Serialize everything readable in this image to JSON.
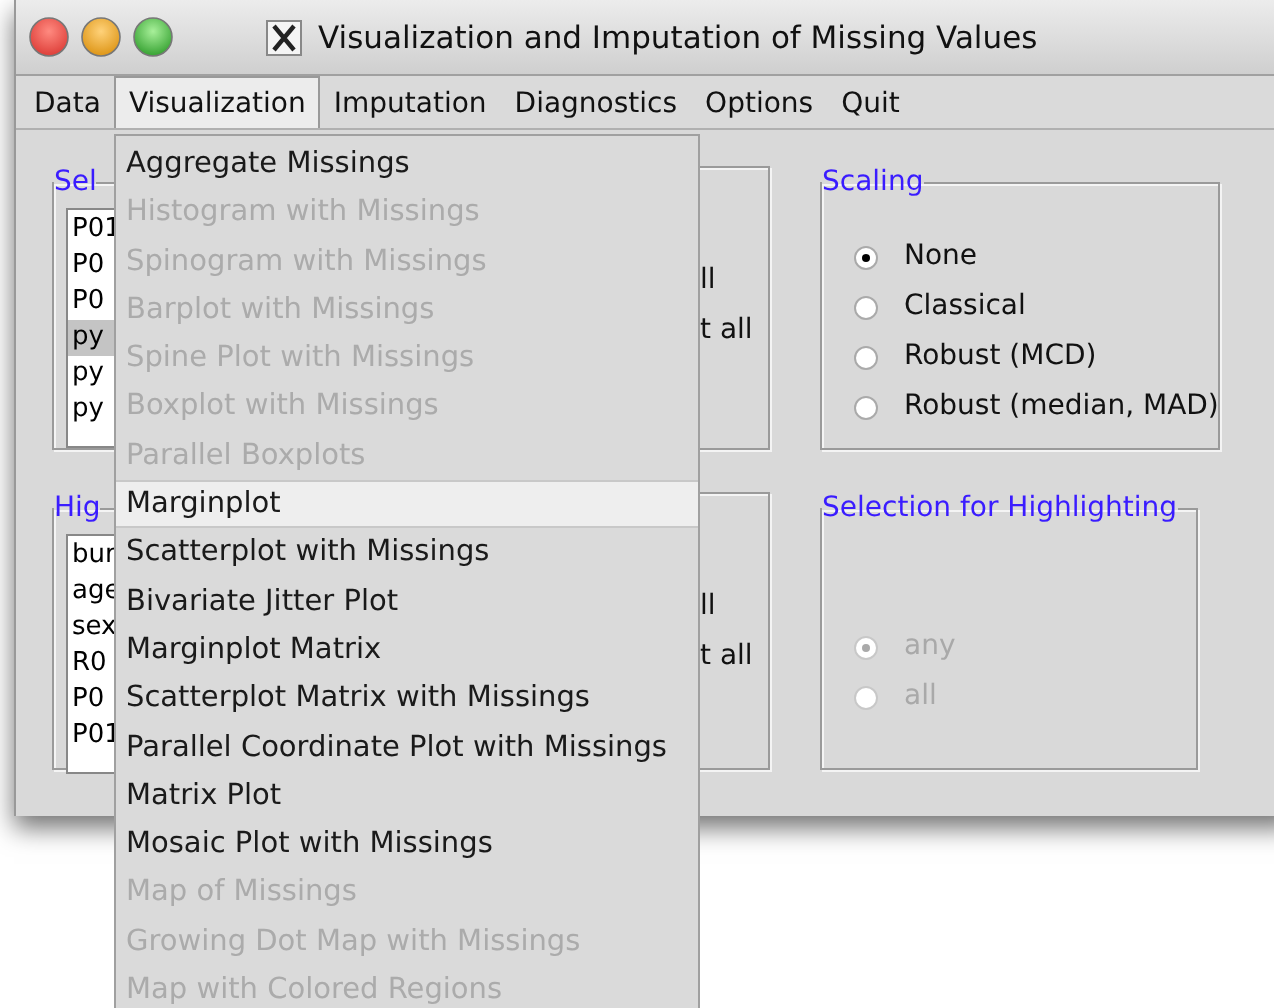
{
  "window": {
    "title": "Visualization and Imputation of Missing Values"
  },
  "menubar": [
    {
      "label": "Data",
      "selected": false
    },
    {
      "label": "Visualization",
      "selected": true
    },
    {
      "label": "Imputation",
      "selected": false
    },
    {
      "label": "Diagnostics",
      "selected": false
    },
    {
      "label": "Options",
      "selected": false
    },
    {
      "label": "Quit",
      "selected": false
    }
  ],
  "left_frames": [
    {
      "legend": "Sel",
      "items": [
        {
          "text": "P01",
          "selected": false
        },
        {
          "text": "P0",
          "selected": false
        },
        {
          "text": "P0",
          "selected": false
        },
        {
          "text": "py",
          "selected": true
        },
        {
          "text": "py",
          "selected": false
        },
        {
          "text": "py",
          "selected": false
        }
      ]
    },
    {
      "legend": "Hig",
      "items": [
        {
          "text": "bur",
          "selected": false
        },
        {
          "text": "age",
          "selected": false
        },
        {
          "text": "sex",
          "selected": false
        },
        {
          "text": "R0",
          "selected": false
        },
        {
          "text": "P0",
          "selected": false
        },
        {
          "text": "P01",
          "selected": false
        }
      ]
    }
  ],
  "middle_frames": [
    {
      "texts": [
        "ll",
        "t all"
      ]
    },
    {
      "texts": [
        "ll",
        "t all"
      ]
    }
  ],
  "scaling": {
    "legend": "Scaling",
    "disabled": false,
    "options": [
      {
        "label": "None",
        "selected": true
      },
      {
        "label": "Classical",
        "selected": false
      },
      {
        "label": "Robust (MCD)",
        "selected": false
      },
      {
        "label": "Robust (median, MAD)",
        "selected": false
      }
    ]
  },
  "highlighting": {
    "legend": "Selection for Highlighting",
    "disabled": true,
    "options": [
      {
        "label": "any",
        "selected": true
      },
      {
        "label": "all",
        "selected": false
      }
    ]
  },
  "visualization_menu": {
    "items": [
      {
        "label": "Aggregate Missings",
        "disabled": false,
        "selected": false
      },
      {
        "label": "Histogram with Missings",
        "disabled": true,
        "selected": false
      },
      {
        "label": "Spinogram with Missings",
        "disabled": true,
        "selected": false
      },
      {
        "label": "Barplot with Missings",
        "disabled": true,
        "selected": false
      },
      {
        "label": "Spine Plot with Missings",
        "disabled": true,
        "selected": false
      },
      {
        "label": "Boxplot with Missings",
        "disabled": true,
        "selected": false
      },
      {
        "label": "Parallel Boxplots",
        "disabled": true,
        "selected": false
      },
      {
        "label": "Marginplot",
        "disabled": false,
        "selected": true
      },
      {
        "label": "Scatterplot with Missings",
        "disabled": false,
        "selected": false
      },
      {
        "label": "Bivariate Jitter Plot",
        "disabled": false,
        "selected": false
      },
      {
        "label": "Marginplot Matrix",
        "disabled": false,
        "selected": false
      },
      {
        "label": "Scatterplot Matrix with Missings",
        "disabled": false,
        "selected": false
      },
      {
        "label": "Parallel Coordinate Plot with Missings",
        "disabled": false,
        "selected": false
      },
      {
        "label": "Matrix Plot",
        "disabled": false,
        "selected": false
      },
      {
        "label": "Mosaic Plot with Missings",
        "disabled": false,
        "selected": false
      },
      {
        "label": "Map of Missings",
        "disabled": true,
        "selected": false
      },
      {
        "label": "Growing Dot Map with Missings",
        "disabled": true,
        "selected": false
      },
      {
        "label": "Map with Colored Regions",
        "disabled": true,
        "selected": false
      }
    ]
  }
}
